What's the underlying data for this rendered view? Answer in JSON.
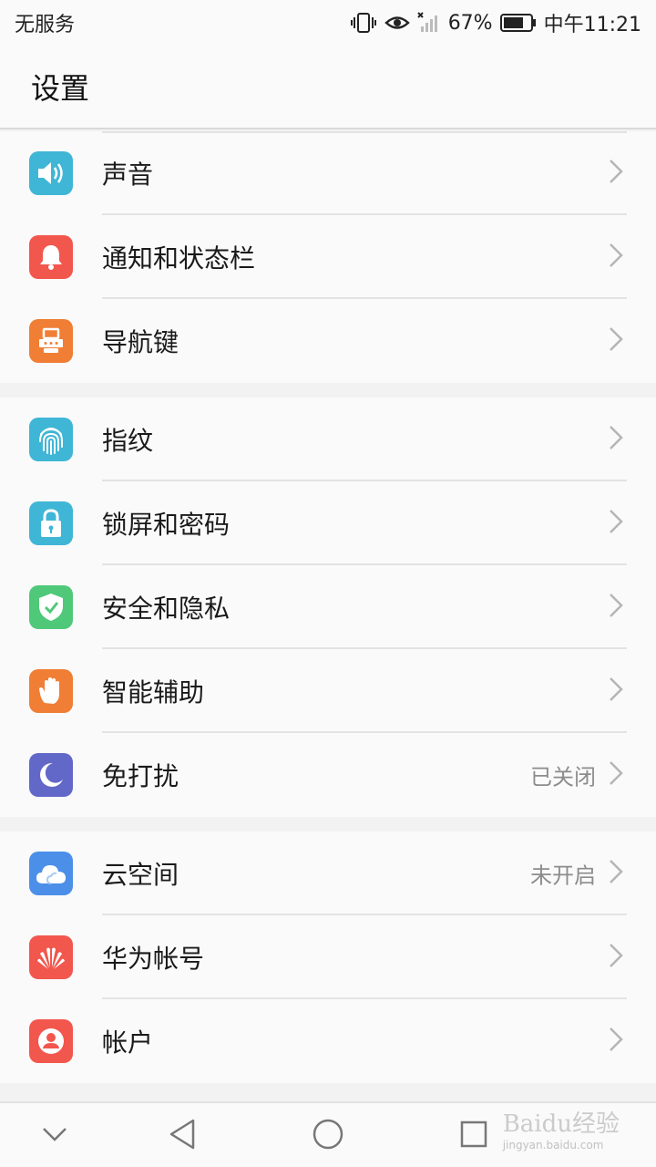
{
  "status_bar": {
    "carrier": "无服务",
    "battery": "67%",
    "time": "中午11:21"
  },
  "header": {
    "title": "设置"
  },
  "groups": [
    {
      "items": [
        {
          "label": "声音",
          "value": "",
          "icon": "speaker-icon",
          "color": "#40b6d6"
        },
        {
          "label": "通知和状态栏",
          "value": "",
          "icon": "bell-icon",
          "color": "#f2574d"
        },
        {
          "label": "导航键",
          "value": "",
          "icon": "navigation-key-icon",
          "color": "#f07e35"
        }
      ]
    },
    {
      "items": [
        {
          "label": "指纹",
          "value": "",
          "icon": "fingerprint-icon",
          "color": "#40b6d6"
        },
        {
          "label": "锁屏和密码",
          "value": "",
          "icon": "lock-icon",
          "color": "#40b6d6"
        },
        {
          "label": "安全和隐私",
          "value": "",
          "icon": "shield-check-icon",
          "color": "#4fc979"
        },
        {
          "label": "智能辅助",
          "value": "",
          "icon": "hand-icon",
          "color": "#f07e35"
        },
        {
          "label": "免打扰",
          "value": "已关闭",
          "icon": "moon-icon",
          "color": "#6268c8"
        }
      ]
    },
    {
      "items": [
        {
          "label": "云空间",
          "value": "未开启",
          "icon": "cloud-icon",
          "color": "#4c8fe8"
        },
        {
          "label": "华为帐号",
          "value": "",
          "icon": "huawei-logo-icon",
          "color": "#f2574d"
        },
        {
          "label": "帐户",
          "value": "",
          "icon": "user-icon",
          "color": "#f2574d"
        }
      ]
    }
  ],
  "watermark": {
    "brand": "Baidu经验",
    "url": "jingyan.baidu.com"
  }
}
